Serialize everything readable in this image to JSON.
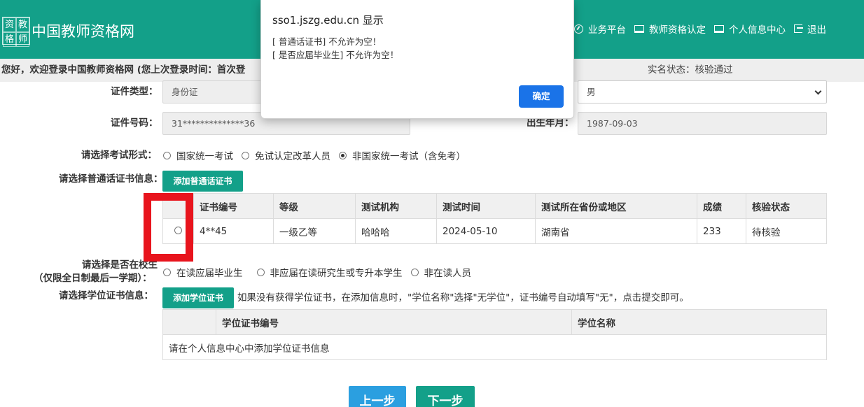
{
  "header": {
    "logo_chars": [
      "资",
      "教",
      "格",
      "师"
    ],
    "site_title": "中国教师资格网",
    "nav": [
      {
        "icon": "dashboard-icon",
        "label": "业务平台"
      },
      {
        "icon": "laptop-icon",
        "label": "教师资格认定"
      },
      {
        "icon": "laptop-icon",
        "label": "个人信息中心"
      },
      {
        "icon": "exit-icon",
        "label": "退出"
      }
    ]
  },
  "welcome": {
    "text": "您好，欢迎登录中国教师资格网 (您上次登录时间：首次登",
    "realname_status": "实名状态：核验通过"
  },
  "form": {
    "id_type_label": "证件类型：",
    "id_type_value": "身份证",
    "gender_value": "男",
    "id_number_label": "证件号码：",
    "id_number_value": "31**************36",
    "birth_label": "出生年月：",
    "birth_value": "1987-09-03",
    "exam_form_label": "请选择考试形式：",
    "exam_options": [
      "国家统一考试",
      "免试认定改革人员",
      "非国家统一考试（含免考）"
    ],
    "exam_selected": 2,
    "mandarin_label": "请选择普通话证书信息：",
    "add_mandarin_btn": "添加普通话证书",
    "mandarin_table": {
      "headers": [
        "",
        "证书编号",
        "等级",
        "测试机构",
        "测试时间",
        "测试所在省份或地区",
        "成绩",
        "核验状态"
      ],
      "rows": [
        [
          "",
          "4**45",
          "一级乙等",
          "哈哈哈",
          "2024-05-10",
          "湖南省",
          "233",
          "待核验"
        ]
      ]
    },
    "student_label_1": "请选择是否在校生",
    "student_label_2": "（仅限全日制最后一学期）：",
    "student_options": [
      "在读应届毕业生",
      "非应届在读研究生或专升本学生",
      "非在读人员"
    ],
    "degree_label": "请选择学位证书信息：",
    "add_degree_btn": "添加学位证书",
    "degree_hint": "如果没有获得学位证书，在添加信息时，\"学位名称\"选择\"无学位\"，证书编号自动填写\"无\"，点击提交即可。",
    "degree_table": {
      "headers": [
        "",
        "学位证书编号",
        "学位名称"
      ],
      "empty_text": "请在个人信息中心中添加学位证书信息"
    },
    "prev_btn": "上一步",
    "next_btn": "下一步"
  },
  "dialog": {
    "title": "sso1.jszg.edu.cn 显示",
    "line1": "[ 普通话证书] 不允许为空！",
    "line2": "[ 是否应届毕业生] 不允许为空！",
    "ok": "确定"
  },
  "colors": {
    "brand_green": "#13a089",
    "dialog_button": "#1a73e8",
    "prev_button": "#2b9fe0",
    "annotation_red": "#e8141d"
  }
}
